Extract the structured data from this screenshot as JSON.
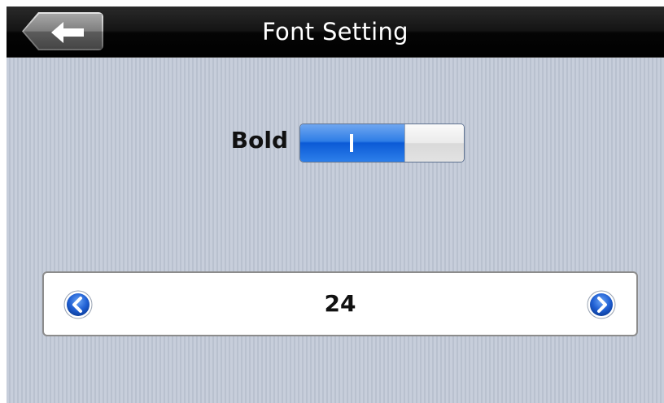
{
  "header": {
    "title": "Font Setting",
    "back_icon": "back-arrow-icon"
  },
  "bold_setting": {
    "label": "Bold",
    "state": "on",
    "on_mark": "I",
    "on_color": "#2f7ee6"
  },
  "font_size": {
    "value": "24",
    "decrease_icon": "chevron-left-icon",
    "increase_icon": "chevron-right-icon",
    "button_color": "#1d56c8"
  }
}
